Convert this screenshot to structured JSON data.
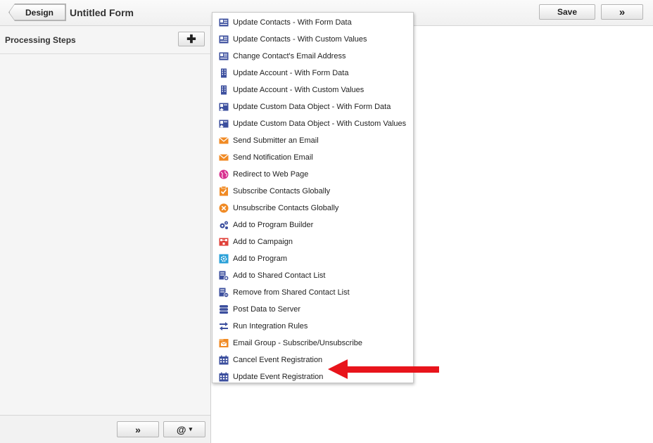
{
  "topbar": {
    "back_label": "Design",
    "form_title": "Untitled Form",
    "save_label": "Save",
    "expand_icon": "double-chevron-right-icon",
    "expand_glyph": "»"
  },
  "left_panel": {
    "title": "Processing Steps",
    "add_icon": "plus-icon",
    "add_glyph": "✚",
    "footer": {
      "next_glyph": "»",
      "at_glyph": "@",
      "at_caret": "▾"
    }
  },
  "menu": {
    "items": [
      {
        "label": "Update Contacts - With Form Data",
        "icon": "contact-card-icon",
        "color": "#3c4f9e"
      },
      {
        "label": "Update Contacts - With Custom Values",
        "icon": "contact-card-icon",
        "color": "#3c4f9e"
      },
      {
        "label": "Change Contact's Email Address",
        "icon": "contact-card-icon",
        "color": "#3c4f9e"
      },
      {
        "label": "Update Account - With Form Data",
        "icon": "building-icon",
        "color": "#3c4f9e"
      },
      {
        "label": "Update Account - With Custom Values",
        "icon": "building-icon",
        "color": "#3c4f9e"
      },
      {
        "label": "Update Custom Data Object - With Form Data",
        "icon": "data-object-icon",
        "color": "#3c4f9e"
      },
      {
        "label": "Update Custom Data Object - With Custom Values",
        "icon": "data-object-icon",
        "color": "#3c4f9e"
      },
      {
        "label": "Send Submitter an Email",
        "icon": "envelope-icon",
        "color": "#f08a24"
      },
      {
        "label": "Send Notification Email",
        "icon": "envelope-icon",
        "color": "#f08a24"
      },
      {
        "label": "Redirect to Web Page",
        "icon": "globe-icon",
        "color": "#d8308f"
      },
      {
        "label": "Subscribe Contacts Globally",
        "icon": "subscribe-check-icon",
        "color": "#f08a24"
      },
      {
        "label": "Unsubscribe Contacts Globally",
        "icon": "unsubscribe-x-icon",
        "color": "#f08a24"
      },
      {
        "label": "Add to Program Builder",
        "icon": "gears-icon",
        "color": "#3c4f9e"
      },
      {
        "label": "Add to Campaign",
        "icon": "campaign-icon",
        "color": "#e0413a"
      },
      {
        "label": "Add to Program",
        "icon": "program-gear-icon",
        "color": "#2aa0d8"
      },
      {
        "label": "Add to Shared Contact List",
        "icon": "list-add-icon",
        "color": "#3c4f9e"
      },
      {
        "label": "Remove from Shared Contact List",
        "icon": "list-remove-icon",
        "color": "#3c4f9e"
      },
      {
        "label": "Post Data to Server",
        "icon": "server-icon",
        "color": "#3c4f9e"
      },
      {
        "label": "Run Integration Rules",
        "icon": "integration-arrows-icon",
        "color": "#3c4f9e"
      },
      {
        "label": "Email Group - Subscribe/Unsubscribe",
        "icon": "email-group-icon",
        "color": "#f08a24"
      },
      {
        "label": "Cancel Event Registration",
        "icon": "calendar-icon",
        "color": "#3c4f9e"
      },
      {
        "label": "Update Event Registration",
        "icon": "calendar-icon",
        "color": "#3c4f9e"
      }
    ]
  },
  "annotation": {
    "arrow_icon": "red-arrow-left-icon",
    "arrow_color": "#e8141b"
  }
}
